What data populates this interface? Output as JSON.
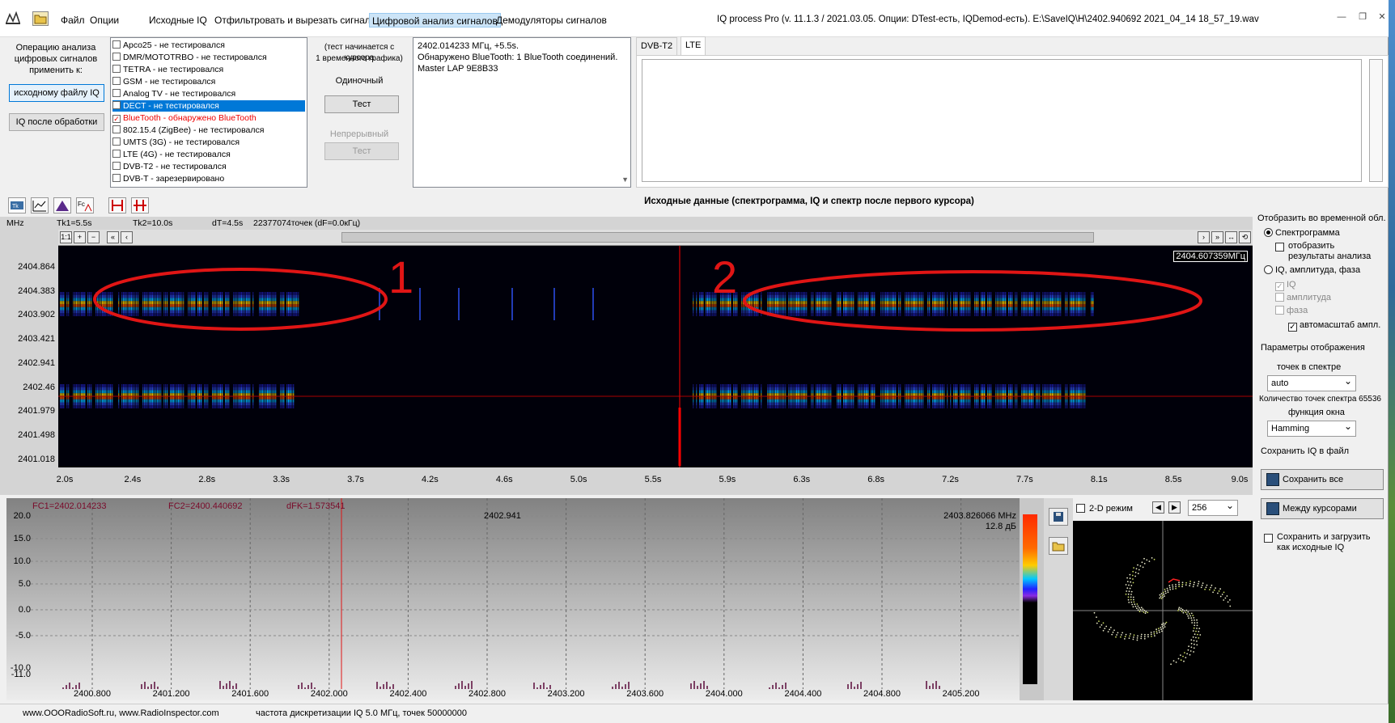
{
  "menu": {
    "items": [
      "Файл",
      "Опции",
      "Исходные IQ",
      "Отфильтровать и вырезать сигнал",
      "Цифровой анализ сигналов",
      "Демодуляторы сигналов"
    ],
    "active_index": 4,
    "title": "IQ process Pro (v. 11.1.3 / 2021.03.05. Опции: DTest-есть, IQDemod-есть). E:\\SaveIQ\\H\\2402.940692 2021_04_14  18_57_19.wav"
  },
  "op_panel": {
    "label": "Операцию анализа цифровых сигналов применить к:",
    "btn_source": "исходному файлу IQ",
    "btn_processed": "IQ после обработки"
  },
  "signals": [
    {
      "label": "Apco25 - не тестировался",
      "checked": false
    },
    {
      "label": "DMR/MOTOTRBO - не тестировался",
      "checked": false
    },
    {
      "label": "TETRA - не тестировался",
      "checked": false
    },
    {
      "label": "GSM - не тестировался",
      "checked": false
    },
    {
      "label": "Analog TV - не тестировался",
      "checked": false
    },
    {
      "label": "DECT - не тестировался",
      "checked": false,
      "highlight": true
    },
    {
      "label": "BlueTooth - обнаружено BlueTooth",
      "checked": true,
      "red": true
    },
    {
      "label": "802.15.4 (ZigBee) - не тестировался",
      "checked": false
    },
    {
      "label": "UMTS (3G) - не тестировался",
      "checked": false
    },
    {
      "label": "LTE (4G) - не тестировался",
      "checked": false
    },
    {
      "label": "DVB-T2 - не тестировался",
      "checked": false
    },
    {
      "label": "DVB-T - зарезервировано",
      "checked": false
    }
  ],
  "test_panel": {
    "note1": "(тест начинается с курсора",
    "note2": "1 временного графика)",
    "single_label": "Одиночный",
    "single_btn": "Тест",
    "cont_label": "Непрерывный",
    "cont_btn": "Тест"
  },
  "result": {
    "line1": "2402.014233 МГц,  +5.5s.",
    "line2": "Обнаружено BlueTooth: 1 BlueTooth соединений.",
    "line3": "Master LAP 9E8B33"
  },
  "tabs": [
    "DVB-T2",
    "LTE"
  ],
  "active_tab": 1,
  "source_title": "Исходные данные (спектрограмма, IQ и спектр после первого курсора)",
  "specgram": {
    "unit": "MHz",
    "tk1": "Tk1=5.5s",
    "tk2": "Tk2=10.0s",
    "dt": "dT=4.5s",
    "points": "22377074точек (dF=0.0кГц)",
    "y_ticks": [
      "2404.864",
      "2404.383",
      "2403.902",
      "2403.421",
      "2402.941",
      "2402.46",
      "2401.979",
      "2401.498",
      "2401.018"
    ],
    "x_ticks": [
      "2.0s",
      "2.4s",
      "2.8s",
      "3.3s",
      "3.7s",
      "4.2s",
      "4.6s",
      "5.0s",
      "5.5s",
      "5.9s",
      "6.3s",
      "6.8s",
      "7.2s",
      "7.7s",
      "8.1s",
      "8.5s",
      "9.0s"
    ],
    "freq_tag": "2404.607359МГц",
    "annot1": "1",
    "annot2": "2"
  },
  "rpanel": {
    "title": "Отобразить во временной обл.",
    "opt_spectrogram": "Спектрограмма",
    "opt_show_results": "отобразить результаты анализа",
    "opt_iq": "IQ, амплитуда, фаза",
    "ck_iq": "IQ",
    "ck_ampl": "амплитуда",
    "ck_phase": "фаза",
    "ck_autoscale": "автомасштаб ампл.",
    "disp_params": "Параметры отображения",
    "points_label": "точек в спектре",
    "points_value": "auto",
    "points_count": "Количество точек спектра 65536",
    "window_label": "функция окна",
    "window_value": "Hamming",
    "save_title": "Сохранить IQ в файл",
    "save_all": "Сохранить все",
    "save_between": "Между курсорами",
    "save_load": "Сохранить и загрузить как исходные IQ"
  },
  "spectrum": {
    "fc1": "FC1=2402.014233",
    "fc2": "FC2=2400.440692",
    "dfk": "dFK=1.573541",
    "center": "2402.941",
    "marker_freq": "2403.826066 MHz",
    "marker_db": "12.8 дБ",
    "y_ticks": [
      "20.0",
      "15.0",
      "10.0",
      "5.0",
      "0.0",
      "-5.0",
      "-10.0",
      "-11.0"
    ],
    "x_ticks": [
      "2400.800",
      "2401.200",
      "2401.600",
      "2402.000",
      "2402.400",
      "2402.800",
      "2403.200",
      "2403.600",
      "2404.000",
      "2404.400",
      "2404.800",
      "2405.200"
    ]
  },
  "constel": {
    "mode_label": "2-D режим",
    "size_value": "256"
  },
  "status": {
    "site": "www.OOORadioSoft.ru, www.RadioInspector.com",
    "info": "частота дискретизации IQ 5.0 МГц, точек 50000000"
  }
}
